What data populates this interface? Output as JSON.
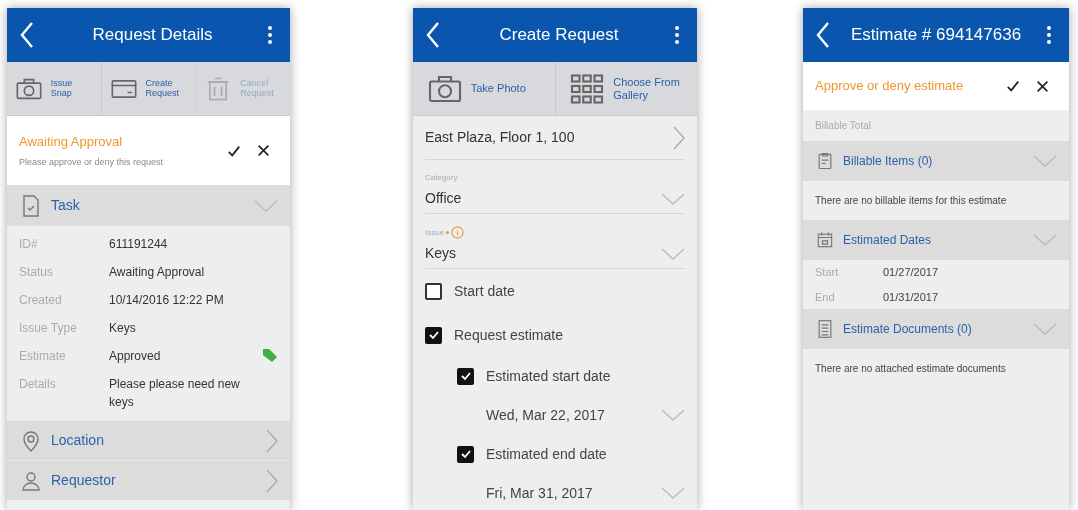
{
  "screens": [
    {
      "kind": "details",
      "title": "Request Details",
      "actions": [
        {
          "label": "Issue Snap",
          "disabled": false
        },
        {
          "label": "Create Request",
          "disabled": false
        },
        {
          "label": "Cancel Request",
          "disabled": true
        }
      ],
      "banner": {
        "title": "Awaiting Approval",
        "message": "Please approve or deny this request"
      },
      "section": {
        "title": "Task",
        "expanded": true,
        "fields": [
          {
            "label": "ID#",
            "value": "611191244",
            "tag": false
          },
          {
            "label": "Status",
            "value": "Awaiting Approval",
            "tag": false
          },
          {
            "label": "Created",
            "value": "10/14/2016 12:22 PM",
            "tag": false
          },
          {
            "label": "Issue Type",
            "value": "Keys",
            "tag": false
          },
          {
            "label": "Estimate",
            "value": "Approved",
            "tag": true
          },
          {
            "label": "Details",
            "value": "Please please need new keys",
            "tag": false
          }
        ]
      },
      "links": [
        {
          "label": "Location"
        },
        {
          "label": "Requestor"
        }
      ]
    },
    {
      "kind": "create",
      "title": "Create Request",
      "actions": [
        {
          "label": "Take Photo",
          "disabled": false
        },
        {
          "label": "Choose From Gallery",
          "disabled": false
        }
      ],
      "location": "East Plaza, Floor 1, 100",
      "fields": [
        {
          "label": "Category",
          "required": false,
          "value": "Office"
        },
        {
          "label": "Issue",
          "required": true,
          "value": "Keys"
        }
      ],
      "checks": [
        {
          "label": "Start date",
          "checked": false
        },
        {
          "label": "Request estimate",
          "checked": true,
          "children": [
            {
              "label": "Estimated start date",
              "checked": true,
              "date": "Wed, Mar 22, 2017"
            },
            {
              "label": "Estimated end date",
              "checked": true,
              "date": "Fri, Mar 31, 2017"
            }
          ]
        }
      ]
    },
    {
      "kind": "estimate",
      "title": "Estimate # 694147636",
      "banner": {
        "title": "Approve or deny estimate"
      },
      "total_label": "Billable Total",
      "sections": [
        {
          "title": "Billable Items (0)",
          "expanded": true,
          "empty": "There are no billable items for this estimate"
        },
        {
          "title": "Estimated Dates",
          "expanded": true,
          "fields": [
            {
              "label": "Start",
              "value": "01/27/2017"
            },
            {
              "label": "End",
              "value": "01/31/2017"
            }
          ]
        },
        {
          "title": "Estimate Documents (0)",
          "expanded": true,
          "empty": "There are no attached estimate documents"
        }
      ]
    }
  ]
}
